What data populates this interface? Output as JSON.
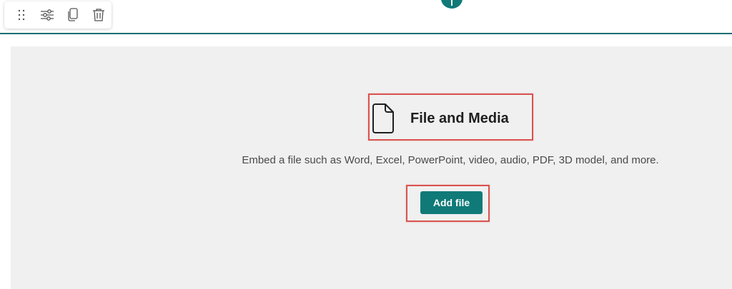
{
  "toolbar": {
    "buttons": [
      {
        "icon": "drag-handle-icon"
      },
      {
        "icon": "edit-properties-icon"
      },
      {
        "icon": "duplicate-icon"
      },
      {
        "icon": "delete-icon"
      }
    ]
  },
  "add_section": {
    "icon": "plus-icon"
  },
  "webpart": {
    "icon": "document-icon",
    "title": "File and Media",
    "description": "Embed a file such as Word, Excel, PowerPoint, video, audio, PDF, 3D model, and more.",
    "button_label": "Add file"
  },
  "colors": {
    "accent": "#0f7a78",
    "section_line": "#1c6e72",
    "placeholder_bg": "#f0f0f0",
    "annotation": "#d9534f"
  }
}
